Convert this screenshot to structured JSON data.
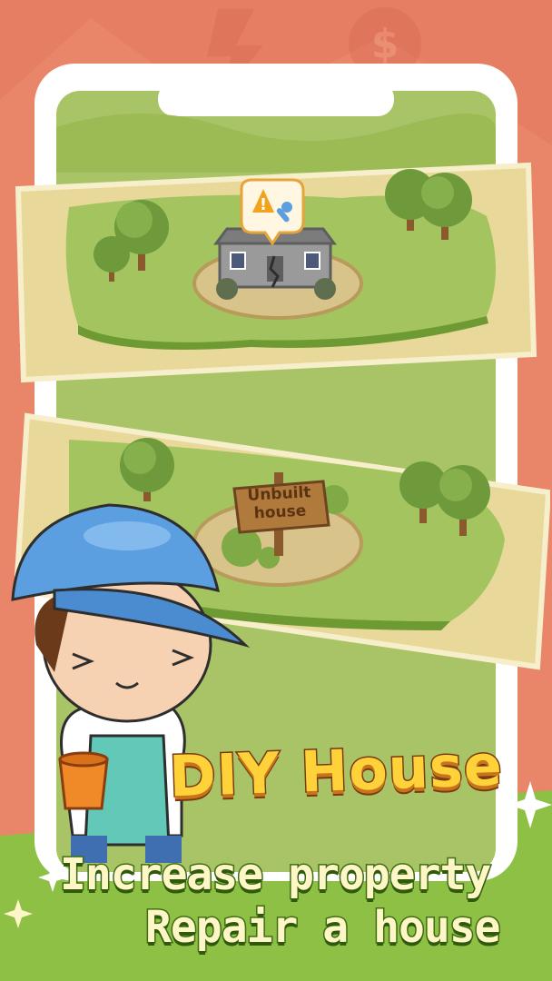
{
  "screen": {
    "headline": "DIY House",
    "subtitle_line1": "Increase property",
    "subtitle_line2": "Repair a house"
  },
  "plots": [
    {
      "name": "damaged-house-plot",
      "status_icons": [
        "warning-icon",
        "wrench-icon"
      ]
    },
    {
      "name": "unbuilt-plot",
      "sign_text": "Unbuilt house"
    }
  ],
  "sign": {
    "line1": "Unbuilt",
    "line2": "house"
  },
  "colors": {
    "background": "#e9866a",
    "grass": "#a9c466",
    "headline_fill": "#ffd23a",
    "subtitle_fill": "#fff6c8",
    "cap": "#5b9fe0"
  }
}
